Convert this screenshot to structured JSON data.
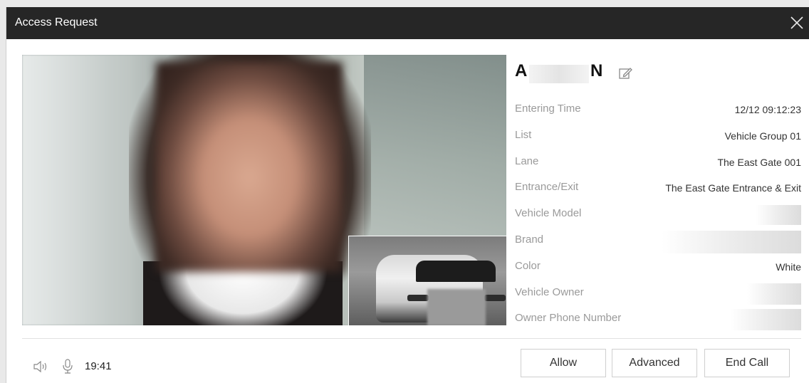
{
  "window": {
    "title": "Access Request"
  },
  "person": {
    "name_initial": "A",
    "name_final": "N"
  },
  "details": [
    {
      "label": "Entering Time",
      "value": "12/12 09:12:23"
    },
    {
      "label": "List",
      "value": "Vehicle Group 01"
    },
    {
      "label": "Lane",
      "value": "The East Gate 001"
    },
    {
      "label": "Entrance/Exit",
      "value": "The East Gate Entrance & Exit"
    },
    {
      "label": "Vehicle Model",
      "value": ""
    },
    {
      "label": "Brand",
      "value": ""
    },
    {
      "label": "Color",
      "value": "White"
    },
    {
      "label": "Vehicle Owner",
      "value": ""
    },
    {
      "label": "Owner Phone Number",
      "value": ""
    }
  ],
  "footer": {
    "call_time": "19:41"
  },
  "buttons": {
    "allow": "Allow",
    "advanced": "Advanced",
    "end_call": "End Call"
  },
  "icons": {
    "close": "close-icon",
    "edit": "edit-icon",
    "speaker": "speaker-icon",
    "mic": "microphone-icon"
  }
}
